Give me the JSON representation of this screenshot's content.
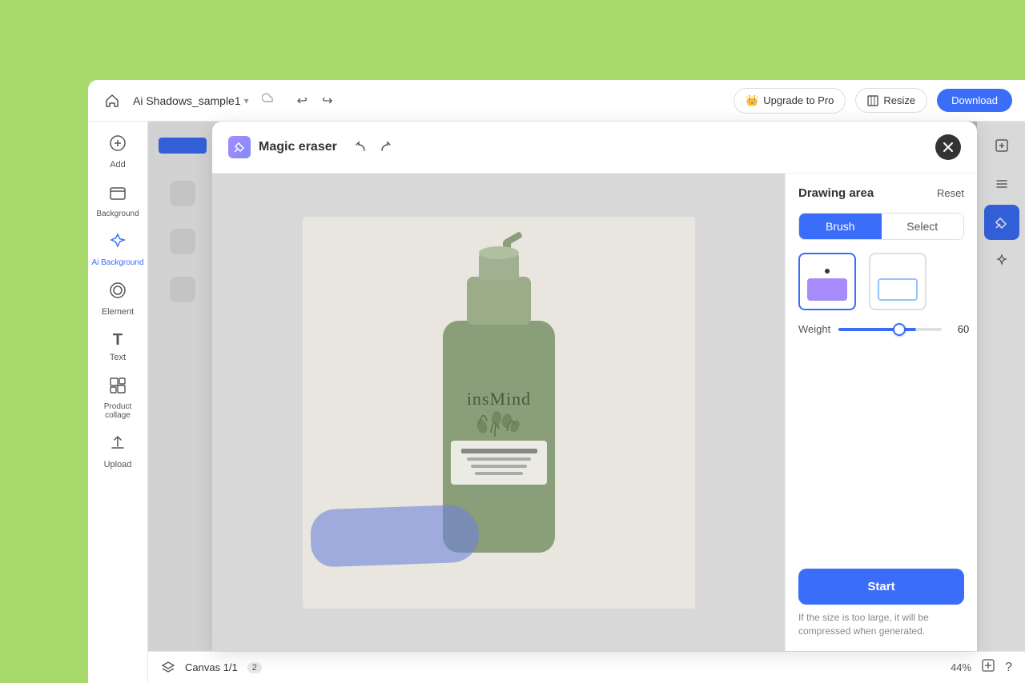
{
  "app": {
    "bg_color": "#a8d96b"
  },
  "header": {
    "home_icon": "⌂",
    "filename": "Ai Shadows_sample1",
    "cloud_icon": "☁",
    "undo_icon": "↩",
    "redo_icon": "↪",
    "upgrade_label": "Upgrade to Pro",
    "resize_label": "Resize",
    "download_label": "Download"
  },
  "sidebar": {
    "items": [
      {
        "icon": "＋",
        "label": "Add"
      },
      {
        "icon": "▦",
        "label": "Background"
      },
      {
        "icon": "✦",
        "label": "Ai Background"
      },
      {
        "icon": "◈",
        "label": "Element"
      },
      {
        "icon": "T",
        "label": "Text"
      },
      {
        "icon": "⊞",
        "label": "Product collage"
      },
      {
        "icon": "⬆",
        "label": "Upload"
      }
    ]
  },
  "modal": {
    "title": "Magic eraser",
    "eraser_icon": "◈",
    "close_icon": "×",
    "undo_icon": "↩",
    "redo_icon": "↪"
  },
  "drawing_area": {
    "title": "Drawing area",
    "reset_label": "Reset",
    "tabs": [
      {
        "id": "brush",
        "label": "Brush"
      },
      {
        "id": "select",
        "label": "Select"
      }
    ],
    "active_tab": "brush",
    "weight_label": "Weight",
    "weight_value": "60",
    "weight_min": "1",
    "weight_max": "100",
    "brush_options": [
      {
        "id": "filled",
        "type": "purple"
      },
      {
        "id": "outline",
        "type": "blue-outline"
      }
    ]
  },
  "footer": {
    "start_label": "Start",
    "note": "If the size is too large, it will be compressed when generated."
  },
  "bottom_bar": {
    "layers_icon": "⊡",
    "canvas_label": "Canvas 1/1",
    "canvas_count": "2",
    "zoom_label": "44%",
    "help_icon": "?",
    "save_icon": "⬡"
  }
}
